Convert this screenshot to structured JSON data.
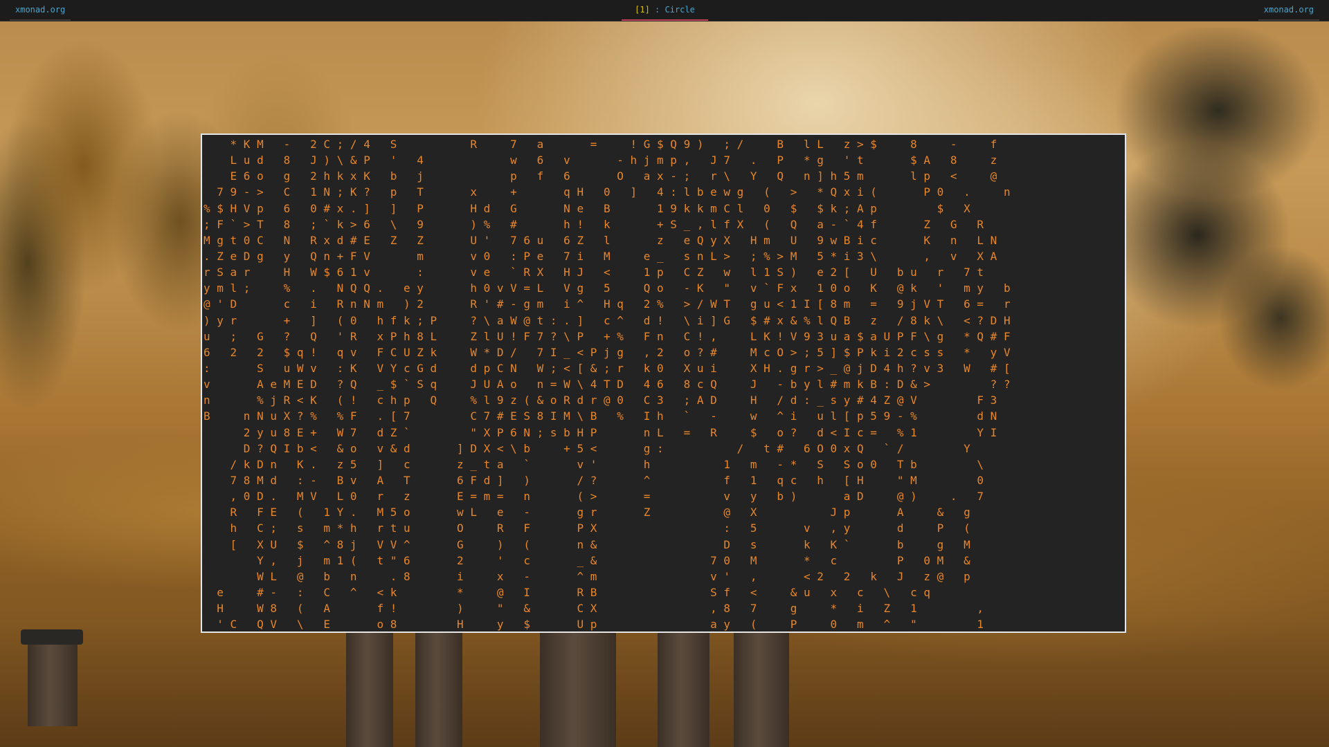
{
  "topbar": {
    "left_label": "xmonad.org",
    "right_label": "xmonad.org",
    "workspace_index": "[1]",
    "separator": " : ",
    "layout_name": "Circle"
  },
  "terminal": {
    "title": "",
    "text_color": "#e8862a",
    "highlight_color": "#f2f2f2",
    "background_color": "#232323",
    "rows": [
      "    * K M   -   2 C ; / 4   S           R     7   a       =     ! G $ Q 9 )   ; /     B   l L   z > $     8     -     f",
      "    L u d   8   J ) \\ & P   '   4             w   6   v       - h j m p ,   J 7   .   P   * g   ' t       $ A   8     z",
      "    E 6 o   g   2 h k x K   b   j             p   f   6       O   a x - ;   r \\   Y   Q   n ] h 5 m       l p   <     @",
      "  7 9 - >   C   1 N ; K ?   p   T       x     +       q H   0   ]   4 : l b e w g   (   >   * Q x i (       P 0   .     n",
      "% $ H V p   6   0 # x . ]   ]   P       H d   G       N e   B       1 9 k k m C l   0   $   $ k ; A p         $   X      ",
      "; F ` > T   8   ; ` k > 6   \\   9       ) %   #       h !   k       + S _ , l f X   (   Q   a - ` 4 f       Z   G   R      ",
      "M g t 0 C   N   R x d # E   Z   Z       U '   7 6 u   6 Z   l       z   e Q y X   H m   U   9 w B i c       K   n   L N    ",
      ". Z e D g   y   Q n + F V       m       v 0   : P e   7 i   M     e _   s n L >   ; % > M   5 * i 3 \\       ,   v   X A    ",
      "r S a r     H   W $ 6 1 v       :       v e   ` R X   H J   <     1 p   C Z   w   l 1 S )   e 2 [   U   b u   r   7 t    ",
      "y m l ;     %   .   N Q Q .   e y       h 0 v V = L   V g   5     Q o   - K   \"   v ` F x   1 0 o   K   @ k   '   m y   b",
      "@ ' D       c   i   R n N m   ) 2       R ' # - g m   i ^   H q   2 %   > / W T   g u < 1 I [ 8 m   =   9 j V T   6 =   r",
      ") y r       +   ]   ( 0   h f k ; P     ? \\ a W @ t : . ]   c ^   d !   \\ i ] G   $ # x & % l Q B   z   / 8 k \\   < ? D H",
      "u   ;   G   ?   Q   ' R   x P h 8 L     Z l U ! F 7 ? \\ P   + %   F n   C ! ,     L K ! V 9 3 u a $ a U P F \\ g   * Q # F",
      "6   2   2   $ q !   q v   F C U Z k     W * D /   7 I _ < P j g   , 2   o ? #     M c O > ; 5 ] $ P k i 2 c s s   *   y V",
      ":       S   u W v   : K   V Y c G d     d p C N   W ; < [ & ; r   k 0   X u i     X H . g r > _ @ j D 4 h ? v 3   W   # [",
      "v       A e M E D   ? Q   _ $ ` S q     J U A o   n = W \\ 4 T D   4 6   8 c Q     J   - b y l # m k B : D & >         ? ?",
      "n       % j R < K   ( !   c h p   Q     % l 9 z ( & o R d r @ 0   C 3   ; A D     H   / d : _ s y # 4 Z @ V         F 3",
      "B     n N u X ? %   % F   . [ 7         C 7 # E S 8 I M \\ B   %   I h   `   -     w   ^ i   u l [ p 5 9 - %         d N",
      "      2 y u 8 E +   W 7   d Z `         \" X P 6 N ; s b H P       n L   =   R     $   o ?   d < I c =   % 1         Y I",
      "      D ? Q I b <   & o   v & d       ] D X < \\ b     + 5 <       g :           /   t #   6 O 0 x Q   ` /         Y  ",
      "    / k D n   K .   z 5   ]   c       z _ t a   `       v '       h           1   m   - *   S   S o 0   T b         \\  ",
      "    7 8 M d   : -   B v   A   T       6 F d ]   )       / ?       ^           f   1   q c   h   [ H     \" M         0  ",
      "    , 0 D .   M V   L 0   r   z       E = m =   n       ( >       =           v   y   b )       a D     @ )     .   7  ",
      "    R   F E   (   1 Y .   M 5 o       w L   e   -       g r       Z           @   X           J p       A     &   g  ",
      "    h   C ;   s   m * h   r t u       O     R   F       P X                   :   5       v   , y       d     P   (  ",
      "    [   X U   $   ^ 8 j   V V ^       G     )   (       n &                   D   s       k   K `       b     g   M  ",
      "        Y ,   j   m 1 (   t \" 6       2     '   c       _ &                 7 0   M       *   c         P   0 M   &  ",
      "        W L   @   b   n     . 8       i     x   -       ^ m                 v '   ,       < 2   2   k   J   z @   p  ",
      "  e     # -   :   C   ^   < k         *     @   I       R B                 S f   <     & u   x   c   \\   c q      ",
      "  H     W 8   (   A       f !         )     \"   &       C X                 , 8   7     g     *   i   Z   1         ,",
      "  ' C   Q V   \\   E       o 8         H     y   $       U p                 a y   (     P     0   m   ^   \"         1"
    ]
  }
}
